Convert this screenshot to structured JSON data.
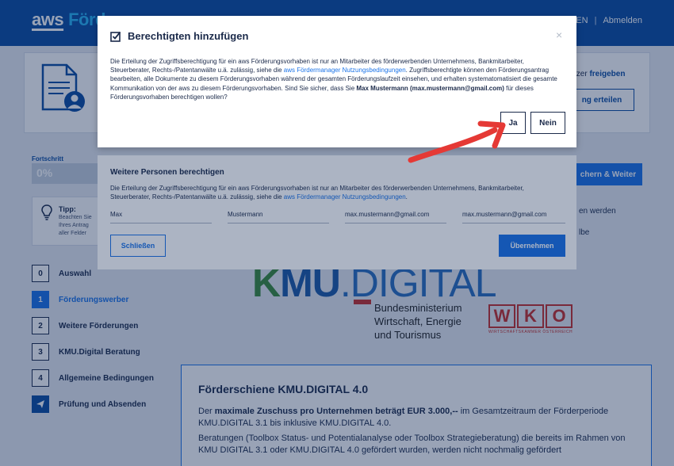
{
  "header": {
    "logo_aws": "aws",
    "logo_brand": "Förd",
    "lang": "E EN",
    "separator": "|",
    "logout": "Abmelden"
  },
  "access_panel": {
    "text_prefix": "tzer",
    "text_link": "freigeben",
    "grant_button": "ng erteilen"
  },
  "progress": {
    "label": "Fortschritt",
    "value": "0%"
  },
  "actions": {
    "save_next": "chern & Weiter"
  },
  "tip": {
    "title": "Tipp:",
    "lines": [
      "Beachten Sie",
      "Ihres Antrag",
      "aller Felder"
    ]
  },
  "right_list": [
    "en werden",
    "lbe"
  ],
  "steps": [
    {
      "num": "0",
      "label": "Auswahl",
      "state": "done"
    },
    {
      "num": "1",
      "label": "Förderungswerber",
      "state": "active"
    },
    {
      "num": "2",
      "label": "Weitere Förderungen",
      "state": "default"
    },
    {
      "num": "3",
      "label": "KMU.Digital Beratung",
      "state": "default"
    },
    {
      "num": "4",
      "label": "Allgemeine Bedingungen",
      "state": "default"
    },
    {
      "num": "",
      "label": "Prüfung und Absenden",
      "state": "send"
    }
  ],
  "branding": {
    "kmu_1": "K",
    "kmu_2": "MU",
    "kmu_3": ".DIGITAL",
    "ministry_lines": [
      "Bundesministerium",
      "Wirtschaft, Energie",
      "und Tourismus"
    ],
    "wko_letters": [
      "W",
      "K",
      "O"
    ],
    "wko_sub": "WIRTSCHAFTSKAMMER ÖSTERREICH"
  },
  "info": {
    "title": "Förderschiene KMU.DIGITAL 4.0",
    "p1_pre": "Der ",
    "p1_bold": "maximale Zuschuss pro Unternehmen beträgt EUR 3.000,--",
    "p1_post": " im Gesamtzeitraum der Förderperiode KMU.DIGITAL 3.1 bis inklusive KMU.DIGITAL 4.0.",
    "p2": "Beratungen (Toolbox Status- und Potentialanalyse oder Toolbox Strategieberatung) die bereits im Rahmen von KMU DIGITAL 3.1 oder KMU.DIGITAL 4.0 gefördert wurden, werden nicht nochmalig gefördert"
  },
  "dialog_persons": {
    "title": "Weitere Personen berechtigen",
    "text_pre": "Die Erteilung der Zugriffsberechtigung für ein aws Förderungsvorhaben ist nur an Mitarbeiter des förderwerbenden Unternehmens, Bankmitarbeiter, Steuerberater, Rechts-/Patentanwälte u.ä. zulässig, siehe die ",
    "text_link": "aws Fördermanager Nutzungsbedingungen",
    "text_post": ".",
    "fields": [
      "Max",
      "Mustermann",
      "max.mustermann@gmail.com",
      "max.mustermann@gmail.com"
    ],
    "close_button": "Schließen",
    "apply_button": "Übernehmen"
  },
  "dialog_confirm": {
    "title": "Berechtigten hinzufügen",
    "close_symbol": "×",
    "text_1": "Die Erteilung der Zugriffsberechtigung für ein aws Förderungsvorhaben ist nur an Mitarbeiter des förderwerbenden Unternehmens, Bankmitarbeiter, Steuerberater, Rechts-/Patentanwälte u.ä. zulässig, siehe die ",
    "text_link": "aws Fördermanager Nutzungsbedingungen",
    "text_2": ". Zugriffsberechtigte können den Förderungsantrag bearbeiten, alle Dokumente zu diesem Förderungsvorhaben während der gesamten Förderungslaufzeit einsehen, und erhalten systematomatisiert die gesamte Kommunikation von der aws zu diesem Förderungsvorhaben. Sind Sie sicher, dass Sie ",
    "text_bold": "Max Mustermann (max.mustermann@gmail.com)",
    "text_3": " für dieses Förderungsvorhaben berechtigen wollen?",
    "yes_button": "Ja",
    "no_button": "Nein"
  },
  "colors": {
    "brand_blue": "#0c4da2",
    "accent_blue": "#1a73e8",
    "arrow_red": "#e53935"
  }
}
